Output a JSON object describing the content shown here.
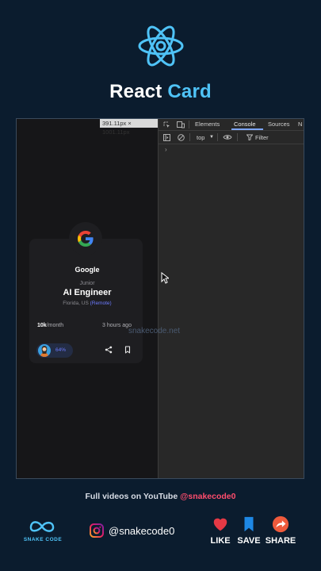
{
  "header": {
    "title_part1": "React",
    "title_part2": "Card"
  },
  "viewport": {
    "dimensions": "391.11px × 1001.11px"
  },
  "card": {
    "company": "Google",
    "level": "Junior",
    "role": "AI Engineer",
    "location": "Florida, US",
    "work_type": "(Remote)",
    "salary_value": "10k",
    "salary_unit": "/month",
    "posted": "3 hours ago",
    "match_percent": "64%"
  },
  "devtools": {
    "tabs": [
      "Elements",
      "Console",
      "Sources",
      "N"
    ],
    "active_tab": "Console",
    "context": "top",
    "filter_placeholder": "Filter",
    "prompt": "›"
  },
  "watermark": "snakecode.net",
  "footer": {
    "promo_text": "Full videos on YouTube",
    "promo_handle": "@snakecode0",
    "brand_name": "SNAKE CODE",
    "instagram_handle": "@snakecode0",
    "actions": [
      "LIKE",
      "SAVE",
      "SHARE"
    ]
  },
  "colors": {
    "background": "#0b1c2e",
    "accent": "#4fc3f7",
    "like": "#e53945",
    "save": "#1e88e5",
    "share": "#ef5a3c"
  }
}
